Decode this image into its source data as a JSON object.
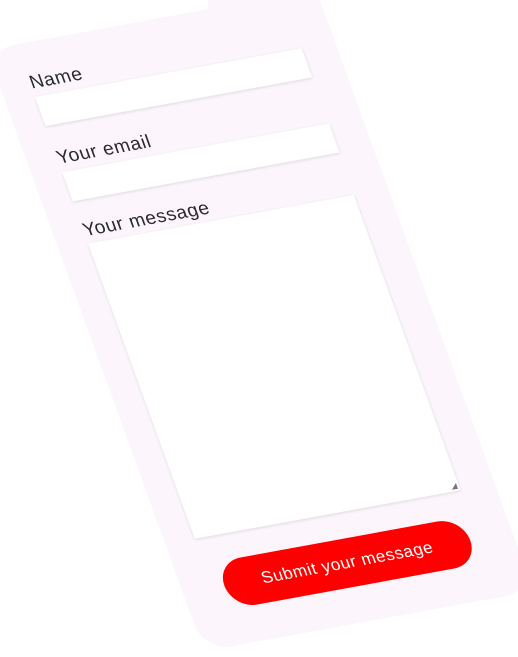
{
  "form": {
    "name_label": "Name",
    "email_label": "Your email",
    "message_label": "Your message",
    "name_value": "",
    "email_value": "",
    "message_value": "",
    "submit_label": "Submit your message"
  },
  "colors": {
    "panel": "#fcf6fc",
    "button": "#ff0000"
  }
}
